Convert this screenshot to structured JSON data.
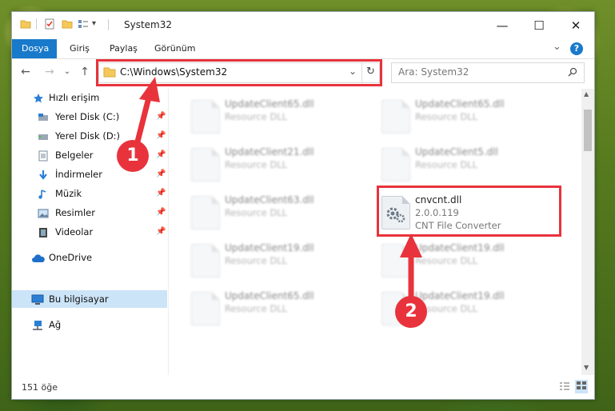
{
  "window": {
    "title": "System32"
  },
  "titlebar": {
    "dropdown_glyph": "▾",
    "minimize": "—",
    "maximize": "☐",
    "close": "✕"
  },
  "ribbon": {
    "tabs": [
      {
        "label": "Dosya",
        "active": true
      },
      {
        "label": "Giriş"
      },
      {
        "label": "Paylaş"
      },
      {
        "label": "Görünüm"
      }
    ],
    "expand_glyph": "⌄",
    "help_glyph": "?"
  },
  "address": {
    "back": "←",
    "forward": "→",
    "recent": "⌄",
    "up": "↑",
    "path": "C:\\Windows\\System32",
    "dropdown": "⌄",
    "refresh": "↻"
  },
  "search": {
    "placeholder": "Ara: System32",
    "icon": "search-icon"
  },
  "sidebar": {
    "items": [
      {
        "label": "Hızlı erişim",
        "icon": "star-icon"
      },
      {
        "label": "Yerel Disk (C:)",
        "icon": "drive-icon",
        "pinned": true
      },
      {
        "label": "Yerel Disk (D:)",
        "icon": "drive-icon",
        "pinned": true
      },
      {
        "label": "Belgeler",
        "icon": "documents-icon",
        "pinned": true
      },
      {
        "label": "İndirmeler",
        "icon": "download-icon",
        "pinned": true
      },
      {
        "label": "Müzik",
        "icon": "music-icon",
        "pinned": true
      },
      {
        "label": "Resimler",
        "icon": "pictures-icon",
        "pinned": true
      },
      {
        "label": "Videolar",
        "icon": "videos-icon",
        "pinned": true
      },
      {
        "label": "OneDrive",
        "icon": "cloud-icon"
      },
      {
        "label": "Bu bilgisayar",
        "icon": "computer-icon",
        "selected": true
      },
      {
        "label": "Ağ",
        "icon": "network-icon"
      }
    ]
  },
  "files": [
    {
      "name": "UpdateClient65.dll",
      "type": "Resource DLL",
      "blurred": true
    },
    {
      "name": "UpdateClient65.dll",
      "type": "Resource DLL",
      "blurred": true
    },
    {
      "name": "UpdateClient21.dll",
      "type": "Resource DLL",
      "blurred": true
    },
    {
      "name": "UpdateClient5.dll",
      "type": "Resource DLL",
      "blurred": true
    },
    {
      "name": "UpdateClient63.dll",
      "type": "Resource DLL",
      "blurred": true
    },
    {
      "name": "cnvcnt.dll",
      "version": "2.0.0.119",
      "description": "CNT File Converter",
      "highlighted": true
    },
    {
      "name": "UpdateClient19.dll",
      "type": "Resource DLL",
      "blurred": true
    },
    {
      "name": "UpdateClient19.dll",
      "type": "Resource DLL",
      "blurred": true
    },
    {
      "name": "UpdateClient65.dll",
      "type": "Resource DLL",
      "blurred": true
    },
    {
      "name": "UpdateClient19.dll",
      "type": "Resource DLL",
      "blurred": true
    }
  ],
  "status": {
    "item_count": "151 öğe"
  },
  "annotations": {
    "badge1": "1",
    "badge2": "2",
    "color": "#e8333c"
  }
}
